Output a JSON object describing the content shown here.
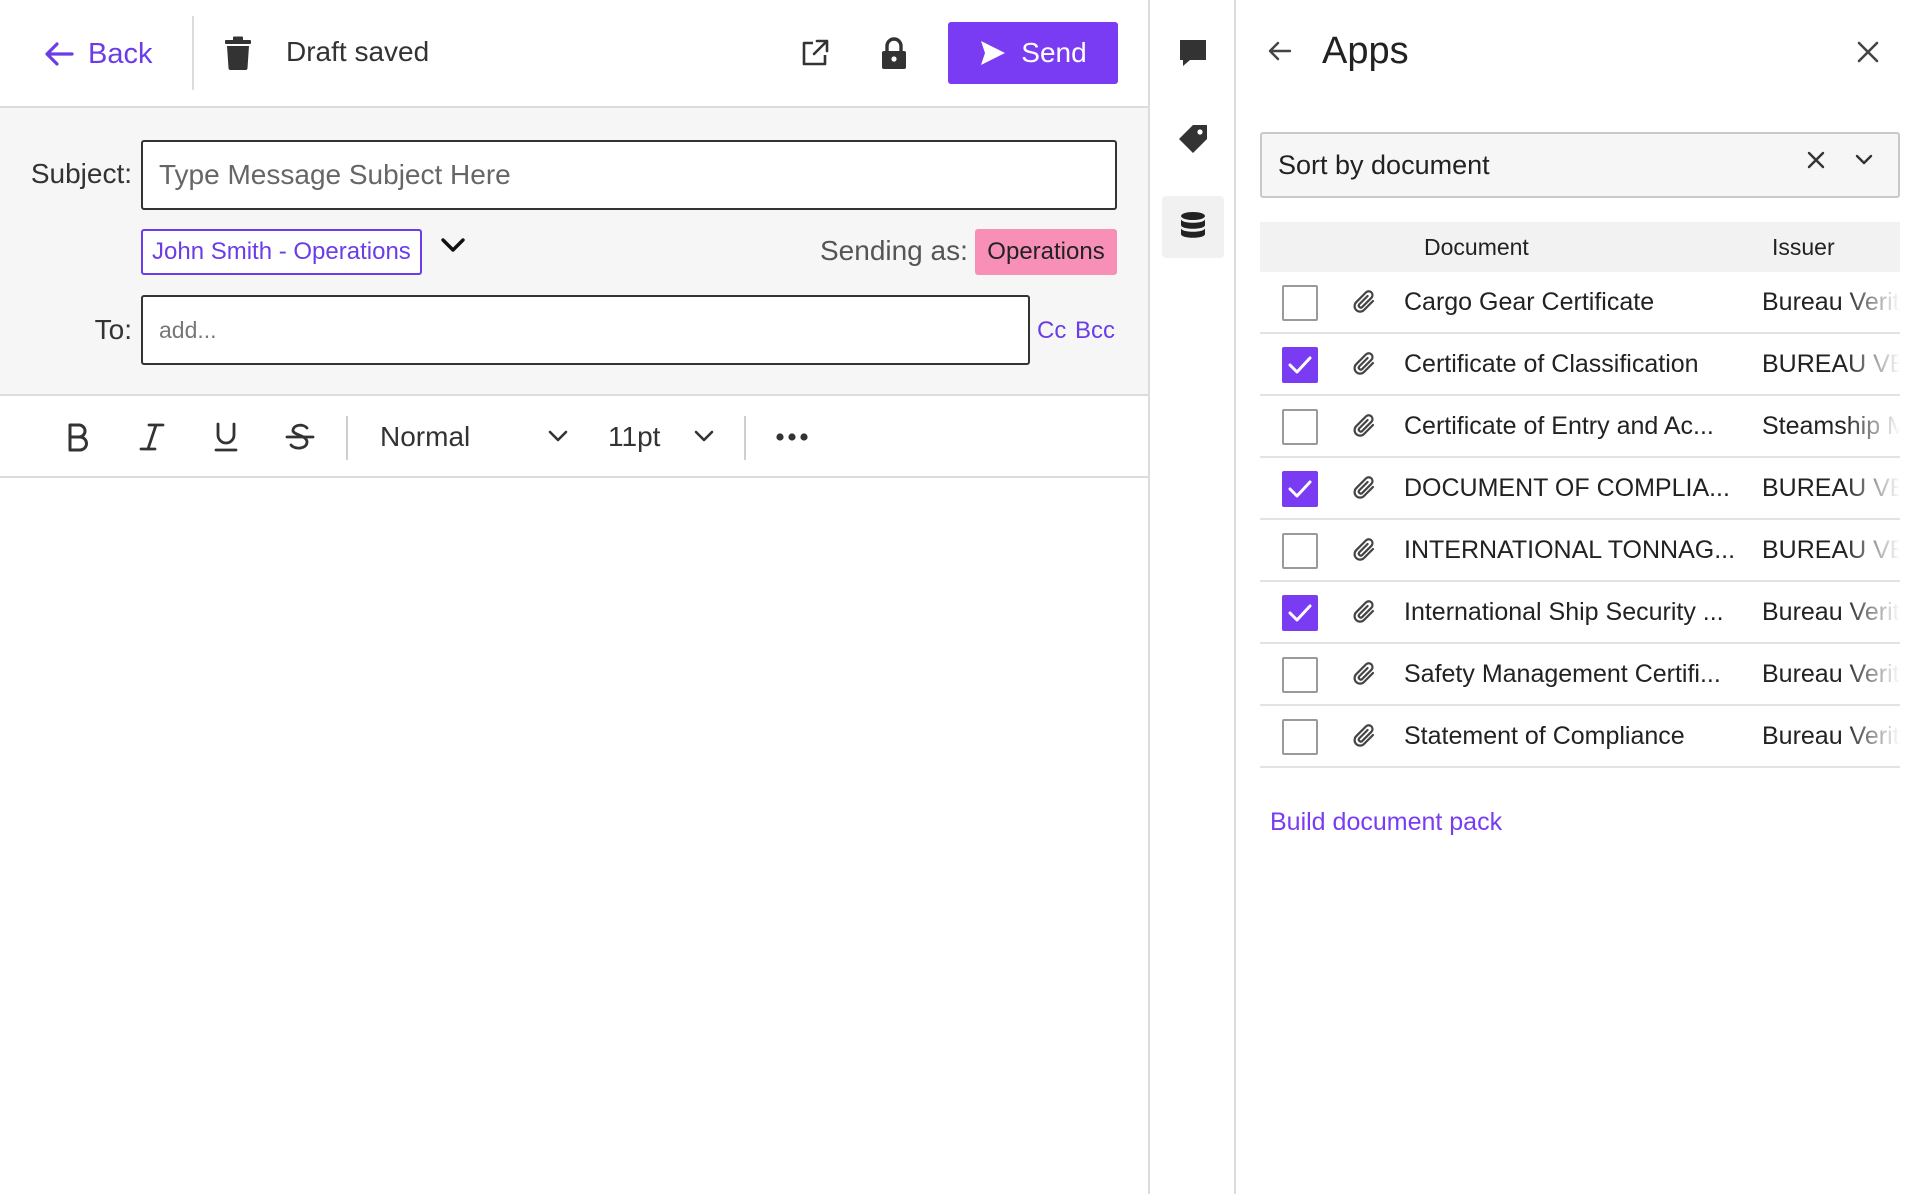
{
  "topbar": {
    "back_label": "Back",
    "draft_status": "Draft saved",
    "send_label": "Send"
  },
  "compose": {
    "subject_label": "Subject:",
    "subject_placeholder": "Type Message Subject Here",
    "from_chip": "John Smith - Operations",
    "sending_as_label": "Sending as:",
    "sending_as_value": "Operations",
    "to_label": "To:",
    "to_placeholder": "add...",
    "cc_label": "Cc",
    "bcc_label": "Bcc"
  },
  "toolbar": {
    "bold_icon": "bold-icon",
    "italic_icon": "italic-icon",
    "underline_icon": "underline-icon",
    "strikethrough_icon": "strikethrough-icon",
    "style_value": "Normal",
    "size_value": "11pt",
    "more_icon": "more-icon"
  },
  "rail": {
    "items": [
      {
        "icon": "comment-icon",
        "active": false
      },
      {
        "icon": "tag-icon",
        "active": false
      },
      {
        "icon": "database-icon",
        "active": true
      }
    ]
  },
  "panel": {
    "title": "Apps",
    "sort_value": "Sort by document",
    "columns": {
      "document": "Document",
      "issuer": "Issuer"
    },
    "rows": [
      {
        "name": "Cargo Gear Certificate",
        "issuer": "Bureau Verit",
        "checked": false
      },
      {
        "name": "Certificate of Classification",
        "issuer": "BUREAU VE",
        "checked": true
      },
      {
        "name": "Certificate of Entry and Ac...",
        "issuer": "Steamship M",
        "checked": false
      },
      {
        "name": "DOCUMENT OF COMPLIA...",
        "issuer": "BUREAU VE",
        "checked": true
      },
      {
        "name": "INTERNATIONAL TONNAG...",
        "issuer": "BUREAU VE",
        "checked": false
      },
      {
        "name": "International Ship Security ...",
        "issuer": "Bureau Verit",
        "checked": true
      },
      {
        "name": "Safety Management Certifi...",
        "issuer": "Bureau Verit",
        "checked": false
      },
      {
        "name": "Statement of Compliance",
        "issuer": "Bureau Verit",
        "checked": false
      }
    ],
    "build_link": "Build document pack"
  },
  "colors": {
    "accent": "#7a3cf3",
    "link": "#6a3de8",
    "sending_badge": "#f78fb7",
    "header_bg": "#f6f6f6"
  }
}
